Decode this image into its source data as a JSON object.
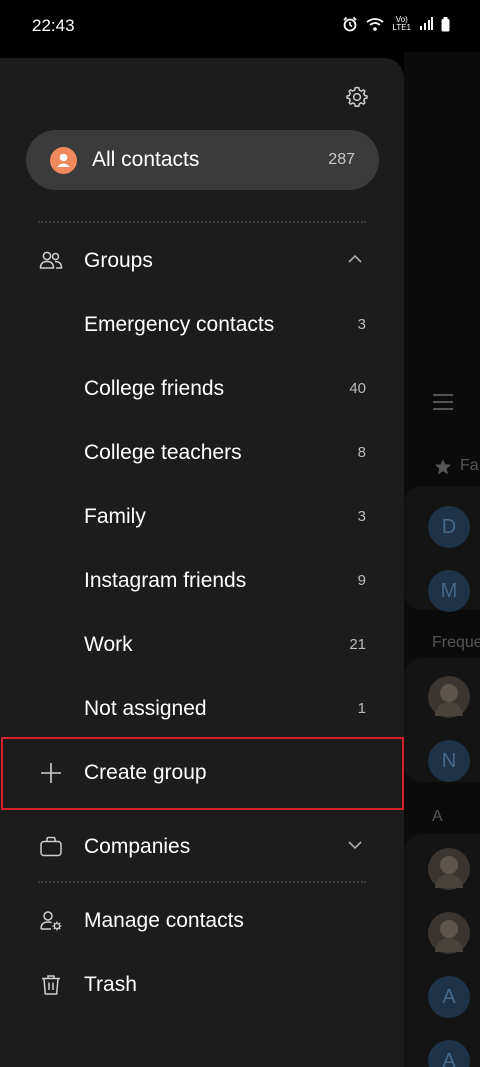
{
  "status_bar": {
    "time": "22:43",
    "network_top": "Vo)",
    "network_bottom": "LTE1"
  },
  "drawer": {
    "settings_icon": "gear-icon",
    "all_contacts": {
      "label": "All contacts",
      "count": "287"
    },
    "groups": {
      "label": "Groups",
      "expanded": true,
      "items": [
        {
          "label": "Emergency contacts",
          "count": "3"
        },
        {
          "label": "College friends",
          "count": "40"
        },
        {
          "label": "College teachers",
          "count": "8"
        },
        {
          "label": "Family",
          "count": "3"
        },
        {
          "label": "Instagram friends",
          "count": "9"
        },
        {
          "label": "Work",
          "count": "21"
        },
        {
          "label": "Not assigned",
          "count": "1"
        }
      ],
      "create_label": "Create group"
    },
    "companies": {
      "label": "Companies",
      "expanded": false
    },
    "manage_contacts": {
      "label": "Manage contacts"
    },
    "trash": {
      "label": "Trash"
    }
  },
  "background": {
    "favorites_label": "Fa",
    "frequent_label": "Freque",
    "section_letter": "A",
    "avatar_letters": [
      "D",
      "M",
      "N",
      "A",
      "A"
    ]
  },
  "colors": {
    "drawer_bg": "#1c1c1c",
    "pill_bg": "#3b3b3b",
    "accent_avatar": "#f08a5d",
    "highlight_border": "#d0212d"
  }
}
